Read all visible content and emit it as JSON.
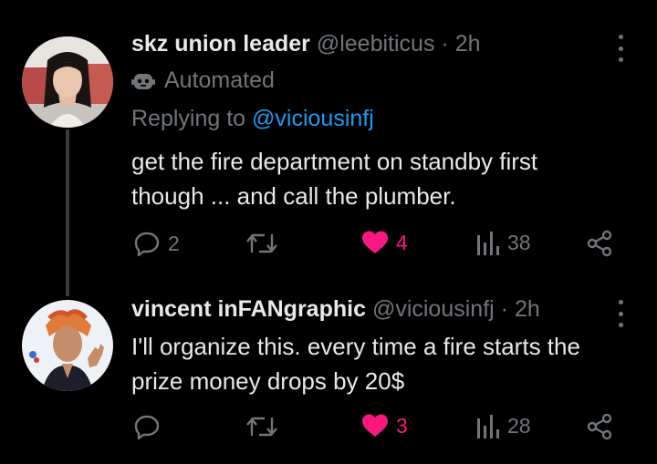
{
  "tweets": [
    {
      "display_name": "skz union leader",
      "handle": "@leebiticus",
      "separator": "·",
      "time": "2h",
      "automated_label": "Automated",
      "replying_prefix": "Replying to",
      "replying_to": "@viciousinfj",
      "text_line1": "get the fire department on standby first",
      "text_line2": "though ... and call the plumber.",
      "replies": "2",
      "retweets": "",
      "likes": "4",
      "views": "38",
      "liked": true,
      "avatar_icon": "avatar-photo"
    },
    {
      "display_name": "vincent inFANgraphic",
      "handle": "@viciousinfj",
      "separator": "·",
      "time": "2h",
      "text_line1": "I'll organize this. every time a fire starts the",
      "text_line2": "prize money drops by 20$",
      "replies": "",
      "retweets": "",
      "likes": "3",
      "views": "28",
      "liked": true,
      "avatar_icon": "avatar-photo"
    }
  ],
  "colors": {
    "background": "#000000",
    "text": "#e7e9ea",
    "secondary": "#71767b",
    "link": "#1d9bf0",
    "like": "#f91880"
  }
}
